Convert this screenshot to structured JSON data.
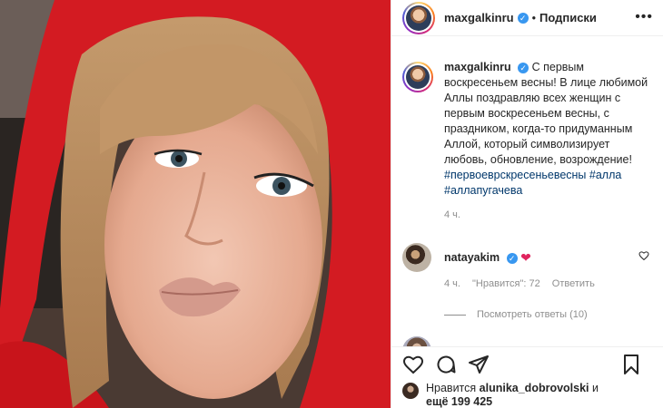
{
  "header": {
    "username": "maxgalkinru",
    "separator": "•",
    "follow_label": "Подписки",
    "more_label": "•••"
  },
  "caption": {
    "username": "maxgalkinru",
    "text": "С первым воскресеньем весны! В лице любимой Аллы поздравляю всех женщин с первым воскресеньем весны, с праздником, когда-то придуманным Аллой, который символизирует любовь, обновление, возрождение!",
    "hashtags": "#первоеврскресеньевесны #алла #аллапугачева",
    "time": "4 ч."
  },
  "comments": [
    {
      "username": "natayakim",
      "emoji": "❤",
      "time": "4 ч.",
      "likes": "\"Нравится\": 72",
      "reply_label": "Ответить",
      "view_replies": "Посмотреть ответы (10)"
    }
  ],
  "actions": {
    "liked_prefix": "Нравится",
    "liked_user": "alunika_dobrovolski",
    "liked_and": "и",
    "liked_more": "ещё 199 425"
  },
  "colors": {
    "accent": "#3897f0",
    "hashtag": "#00376b",
    "secondary": "#8e8e8e",
    "heart": "#e0245e"
  }
}
